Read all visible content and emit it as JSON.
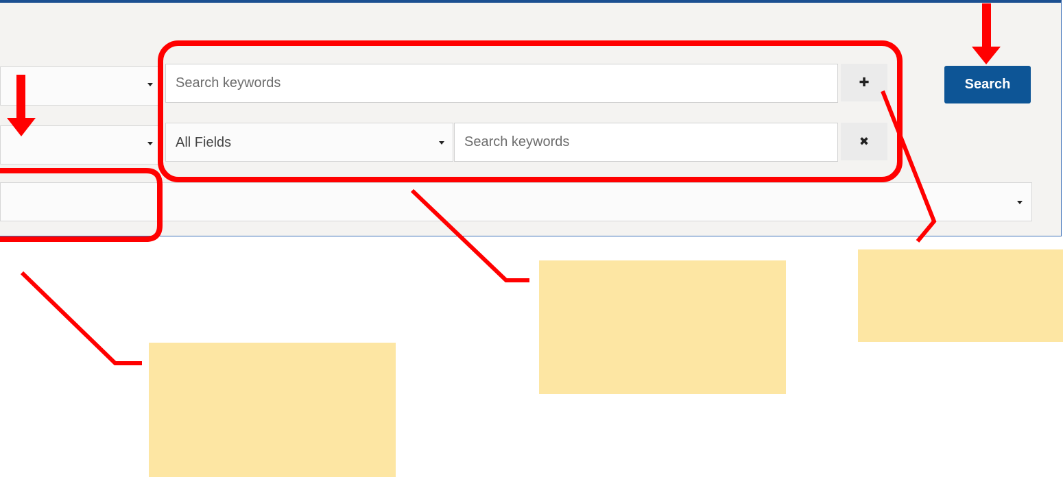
{
  "search_form": {
    "keyword_placeholder_1": "Search keywords",
    "keyword_placeholder_2": "Search keywords",
    "field_select_value": "All Fields",
    "add_row_icon": "plus-icon",
    "add_row_glyph": "✚",
    "remove_row_icon": "close-icon",
    "remove_row_glyph": "✖",
    "search_label": "Search"
  },
  "colors": {
    "accent": "#0d5596",
    "panel_border": "#1b4f91",
    "annotation": "#ff0000",
    "note": "#fde6a3"
  }
}
